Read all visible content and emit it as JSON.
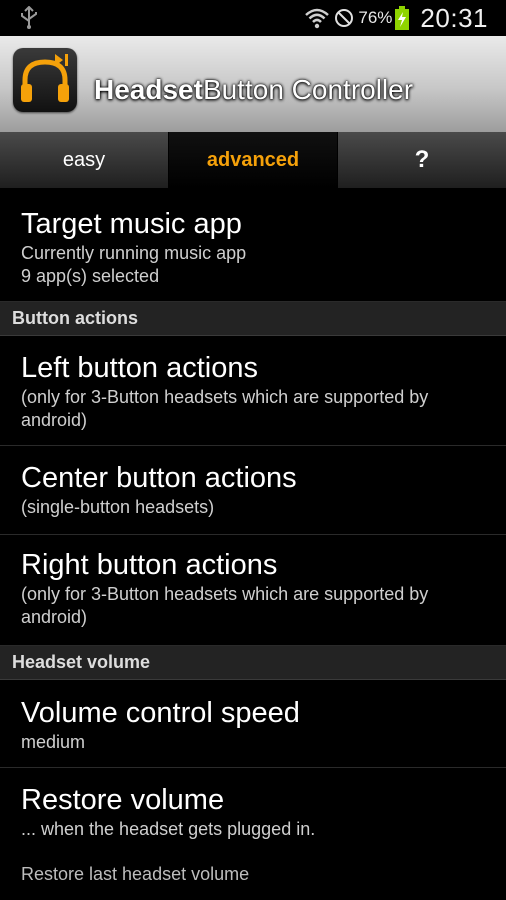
{
  "status": {
    "battery_percent": "76%",
    "time": "20:31"
  },
  "titlebar": {
    "title_bold": "Headset",
    "title_rest": "Button Controller"
  },
  "tabs": [
    {
      "label": "easy"
    },
    {
      "label": "advanced"
    },
    {
      "label": "?"
    }
  ],
  "prefs": {
    "target": {
      "title": "Target music app",
      "summary1": "Currently running music app",
      "summary2": "9 app(s) selected"
    },
    "cat_buttons": "Button actions",
    "left": {
      "title": "Left button actions",
      "summary": "(only for 3-Button headsets which are supported by android)"
    },
    "center": {
      "title": "Center button actions",
      "summary": "(single-button headsets)"
    },
    "right": {
      "title": "Right button actions",
      "summary": "(only for 3-Button headsets which are supported by android)"
    },
    "cat_volume": "Headset volume",
    "speed": {
      "title": "Volume control speed",
      "summary": "medium"
    },
    "restore": {
      "title": "Restore volume",
      "summary": "... when the headset gets plugged in.",
      "option": "Restore last headset volume"
    }
  },
  "colors": {
    "accent": "#f5a10a",
    "battery": "#8fd400"
  }
}
